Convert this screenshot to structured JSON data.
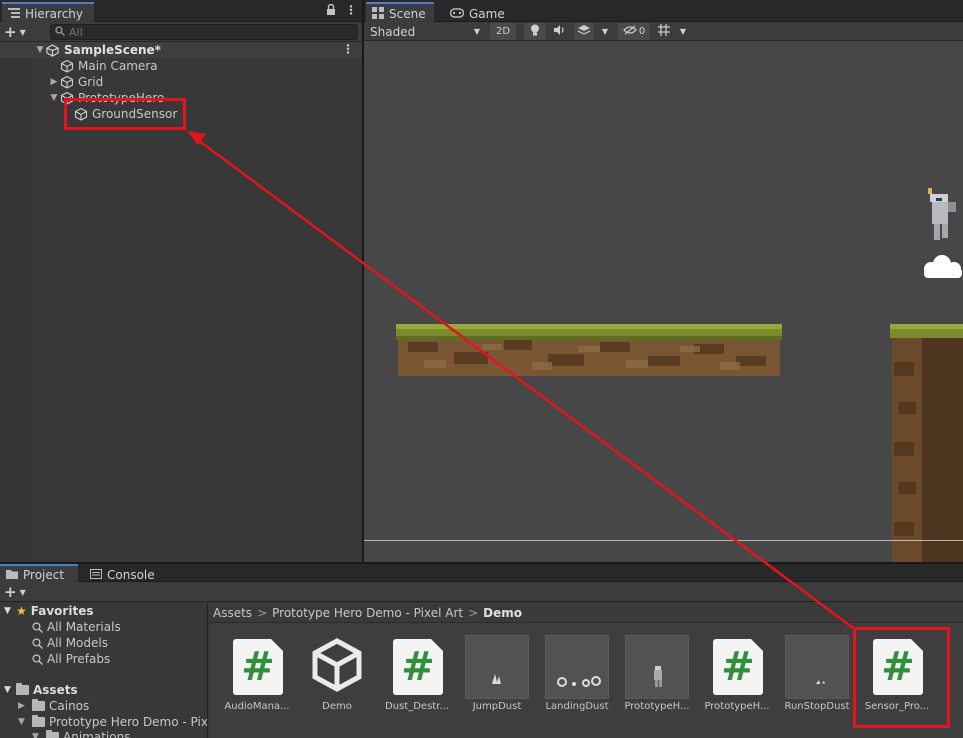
{
  "hierarchy": {
    "tab_label": "Hierarchy",
    "search_placeholder": "All",
    "scene_name": "SampleScene*",
    "items": [
      {
        "label": "Main Camera",
        "depth": 1,
        "expand": "none"
      },
      {
        "label": "Grid",
        "depth": 1,
        "expand": "collapsed"
      },
      {
        "label": "PrototypeHero",
        "depth": 1,
        "expand": "expanded"
      },
      {
        "label": "GroundSensor",
        "depth": 2,
        "expand": "none"
      }
    ]
  },
  "scene": {
    "tabs": [
      {
        "label": "Scene",
        "icon": "scene-grid-icon"
      },
      {
        "label": "Game",
        "icon": "gamepad-icon"
      }
    ],
    "draw_mode": "Shaded",
    "btn_2d": "2D",
    "hidden_count": "0"
  },
  "project": {
    "tabs": [
      {
        "label": "Project",
        "icon": "folder-icon"
      },
      {
        "label": "Console",
        "icon": "console-icon"
      }
    ],
    "favorites": {
      "label": "Favorites",
      "items": [
        "All Materials",
        "All Models",
        "All Prefabs"
      ]
    },
    "assets_label": "Assets",
    "assets_children": [
      "Cainos",
      "Prototype Hero Demo - Pixel Art",
      "Animations"
    ],
    "breadcrumb": [
      "Assets",
      "Prototype Hero Demo - Pixel Art",
      "Demo"
    ],
    "files": [
      {
        "label": "AudioMana...",
        "type": "script"
      },
      {
        "label": "Demo",
        "type": "unity-scene"
      },
      {
        "label": "Dust_Destr...",
        "type": "script"
      },
      {
        "label": "JumpDust",
        "type": "animation"
      },
      {
        "label": "LandingDust",
        "type": "animation"
      },
      {
        "label": "PrototypeH...",
        "type": "animation"
      },
      {
        "label": "PrototypeH...",
        "type": "script"
      },
      {
        "label": "RunStopDust",
        "type": "animation"
      },
      {
        "label": "Sensor_Pro...",
        "type": "script"
      }
    ]
  },
  "annotation": {
    "color": "#e3141b",
    "description_target": "GroundSensor"
  }
}
